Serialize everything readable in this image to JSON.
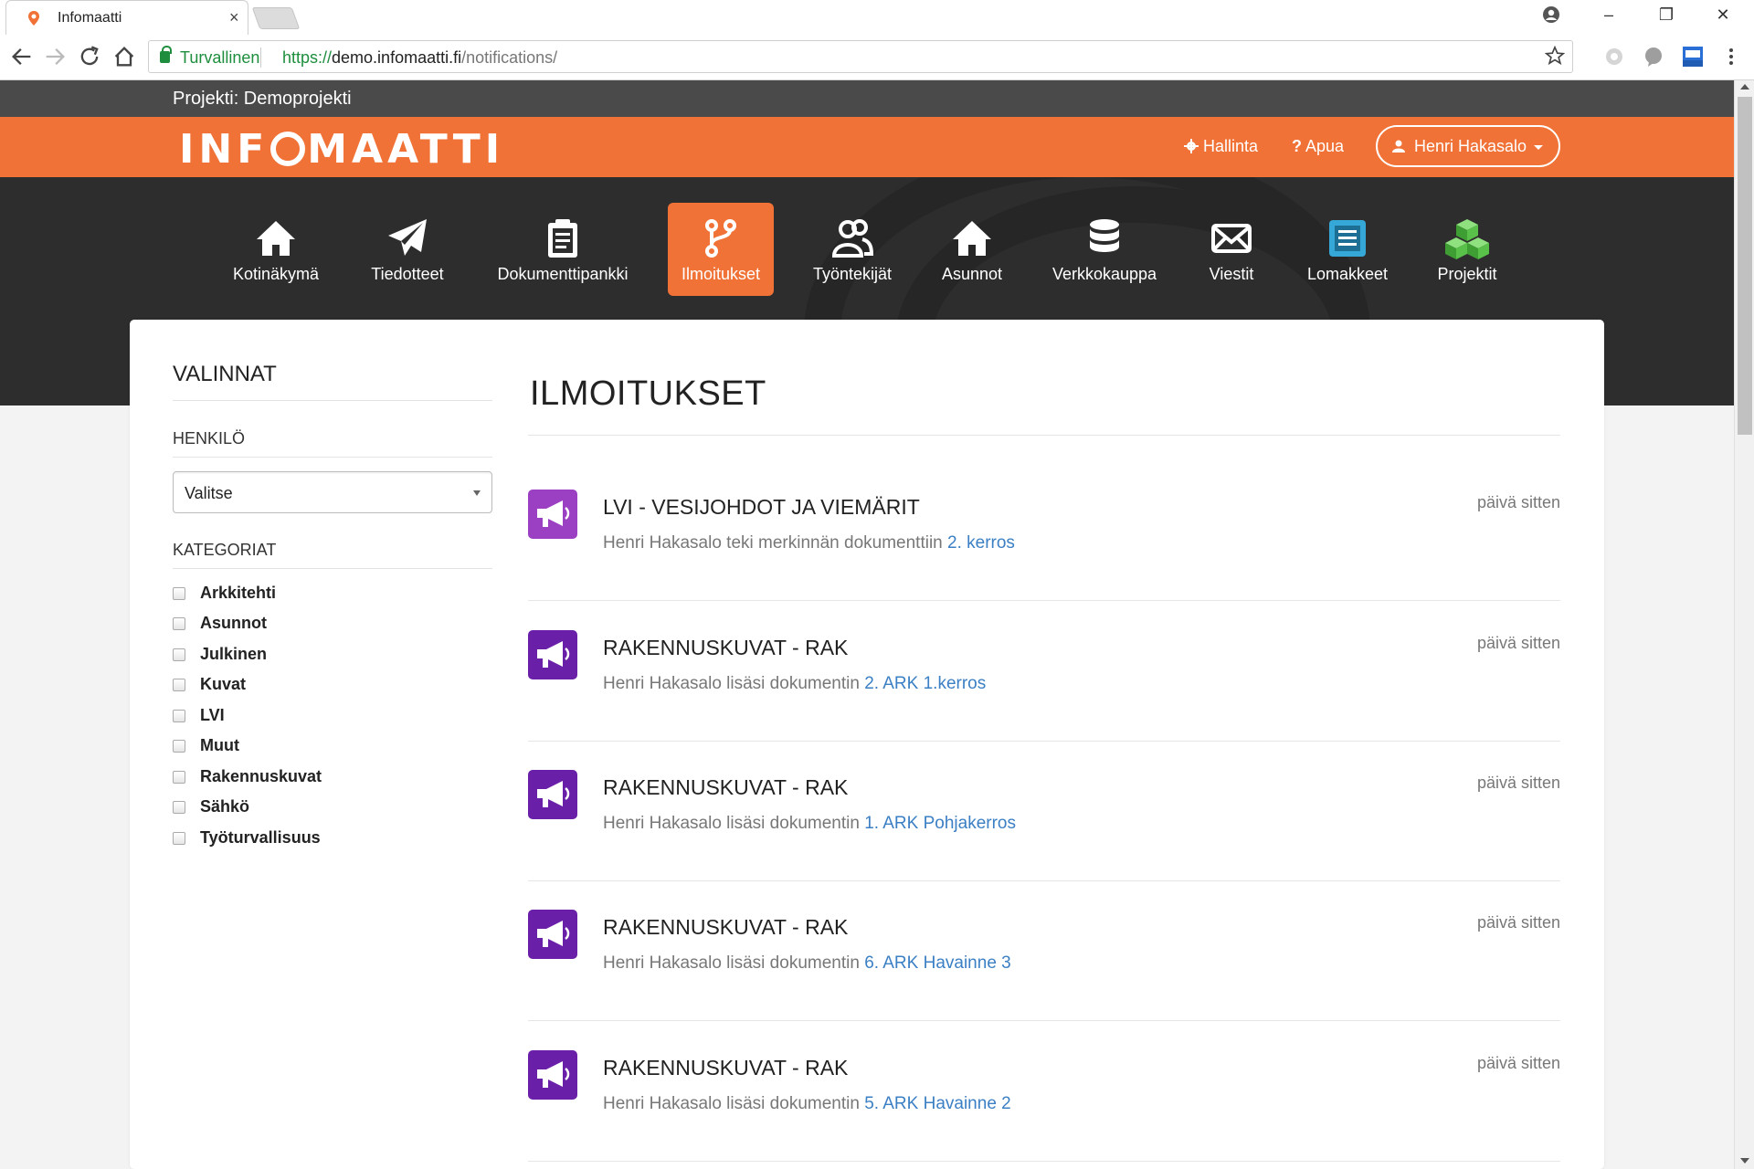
{
  "browser": {
    "tab_title": "Infomaatti",
    "tab_close": "×",
    "secure_label": "Turvallinen",
    "url_scheme": "https://",
    "url_host": "demo.infomaatti.fi",
    "url_path": "/notifications/",
    "window_controls": [
      "–",
      "❐",
      "✕"
    ]
  },
  "header": {
    "project_label": "Projekti: Demoprojekti",
    "logo_left": "INF",
    "logo_right": "MAATTI",
    "admin_link": "Hallinta",
    "help_link": "Apua",
    "user_name": "Henri Hakasalo"
  },
  "nav": {
    "items": [
      {
        "label": "Kotinäkymä",
        "icon": "home-icon"
      },
      {
        "label": "Tiedotteet",
        "icon": "paper-plane-icon"
      },
      {
        "label": "Dokumenttipankki",
        "icon": "clipboard-icon"
      },
      {
        "label": "Ilmoitukset",
        "icon": "branch-icon",
        "active": true
      },
      {
        "label": "Työntekijät",
        "icon": "users-icon"
      },
      {
        "label": "Asunnot",
        "icon": "house-icon"
      },
      {
        "label": "Verkkokauppa",
        "icon": "database-icon"
      },
      {
        "label": "Viestit",
        "icon": "envelope-icon"
      },
      {
        "label": "Lomakkeet",
        "icon": "form-icon"
      },
      {
        "label": "Projektit",
        "icon": "cubes-icon"
      }
    ]
  },
  "sidebar": {
    "title": "VALINNAT",
    "person_label": "HENKILÖ",
    "person_select_value": "Valitse",
    "categories_label": "KATEGORIAT",
    "categories": [
      "Arkkitehti",
      "Asunnot",
      "Julkinen",
      "Kuvat",
      "LVI",
      "Muut",
      "Rakennuskuvat",
      "Sähkö",
      "Työturvallisuus"
    ]
  },
  "main": {
    "title": "ILMOITUKSET",
    "notifications": [
      {
        "title": "LVI - VESIJOHDOT JA VIEMÄRIT",
        "text": "Henri Hakasalo teki merkinnän dokumenttiin ",
        "link": "2. kerros",
        "time": "päivä sitten"
      },
      {
        "title": "RAKENNUSKUVAT - RAK",
        "text": "Henri Hakasalo lisäsi dokumentin ",
        "link": "2. ARK 1.kerros",
        "time": "päivä sitten"
      },
      {
        "title": "RAKENNUSKUVAT - RAK",
        "text": "Henri Hakasalo lisäsi dokumentin ",
        "link": "1. ARK Pohjakerros",
        "time": "päivä sitten"
      },
      {
        "title": "RAKENNUSKUVAT - RAK",
        "text": "Henri Hakasalo lisäsi dokumentin ",
        "link": "6. ARK Havainne 3",
        "time": "päivä sitten"
      },
      {
        "title": "RAKENNUSKUVAT - RAK",
        "text": "Henri Hakasalo lisäsi dokumentin ",
        "link": "5. ARK Havainne 2",
        "time": "päivä sitten"
      }
    ]
  },
  "colors": {
    "brand_orange": "#f07236",
    "dark_band": "#2d2d2d",
    "project_bar": "#4a4a4a",
    "notification_icon": "#6a1fa8",
    "link_blue": "#3b7fc4"
  }
}
